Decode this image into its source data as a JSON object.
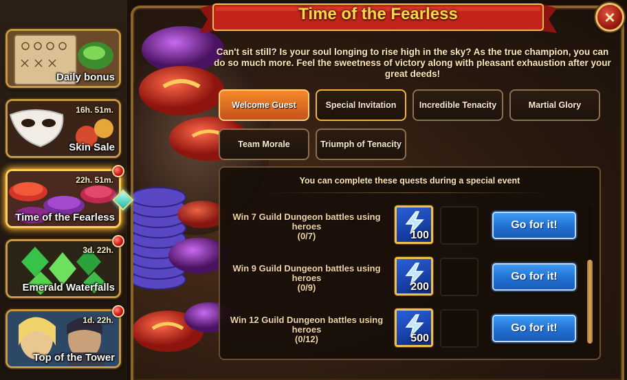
{
  "window": {
    "title": "Time of the Fearless",
    "close_label": "×"
  },
  "sidebar": {
    "items": [
      {
        "label": "Daily bonus",
        "timer": "",
        "notify": false,
        "active": false
      },
      {
        "label": "Skin Sale",
        "timer": "16h. 51m.",
        "notify": false,
        "active": false
      },
      {
        "label": "Time of the Fearless",
        "timer": "22h. 51m.",
        "notify": true,
        "active": true
      },
      {
        "label": "Emerald Waterfalls",
        "timer": "3d. 22h.",
        "notify": true,
        "active": false
      },
      {
        "label": "Top of the Tower",
        "timer": "1d. 22h.",
        "notify": true,
        "active": false
      }
    ]
  },
  "intro": "Can't sit still? Is your soul longing to rise high in the sky? As the true champion, you can do so much more. Feel the sweetness of victory along with pleasant exhaustion after your great deeds!",
  "tabs": [
    {
      "label": "Welcome Guest",
      "state": "active"
    },
    {
      "label": "Special Invitation",
      "state": "highlight"
    },
    {
      "label": "Incredible Tenacity",
      "state": "normal"
    },
    {
      "label": "Martial Glory",
      "state": "normal"
    },
    {
      "label": "Team Morale",
      "state": "normal"
    },
    {
      "label": "Triumph of Tenacity",
      "state": "normal"
    }
  ],
  "panel": {
    "note": "You can complete these quests during a special event",
    "quests": [
      {
        "line1": "Win 7 Guild Dungeon battles using",
        "line2": "heroes",
        "progress": "(0/7)",
        "reward_icon": "lightning-energy-icon",
        "reward_qty": "100",
        "button": "Go for it!"
      },
      {
        "line1": "Win 9 Guild Dungeon battles using",
        "line2": "heroes",
        "progress": "(0/9)",
        "reward_icon": "lightning-energy-icon",
        "reward_qty": "200",
        "button": "Go for it!"
      },
      {
        "line1": "Win 12 Guild Dungeon battles using",
        "line2": "heroes",
        "progress": "(0/12)",
        "reward_icon": "lightning-energy-icon",
        "reward_qty": "500",
        "button": "Go for it!"
      }
    ]
  },
  "colors": {
    "title": "#ffd54a",
    "tab_active": "#e86f22",
    "go_button": "#2b7fe0",
    "frame_gold": "#c79a45",
    "notify_red": "#d31717"
  }
}
